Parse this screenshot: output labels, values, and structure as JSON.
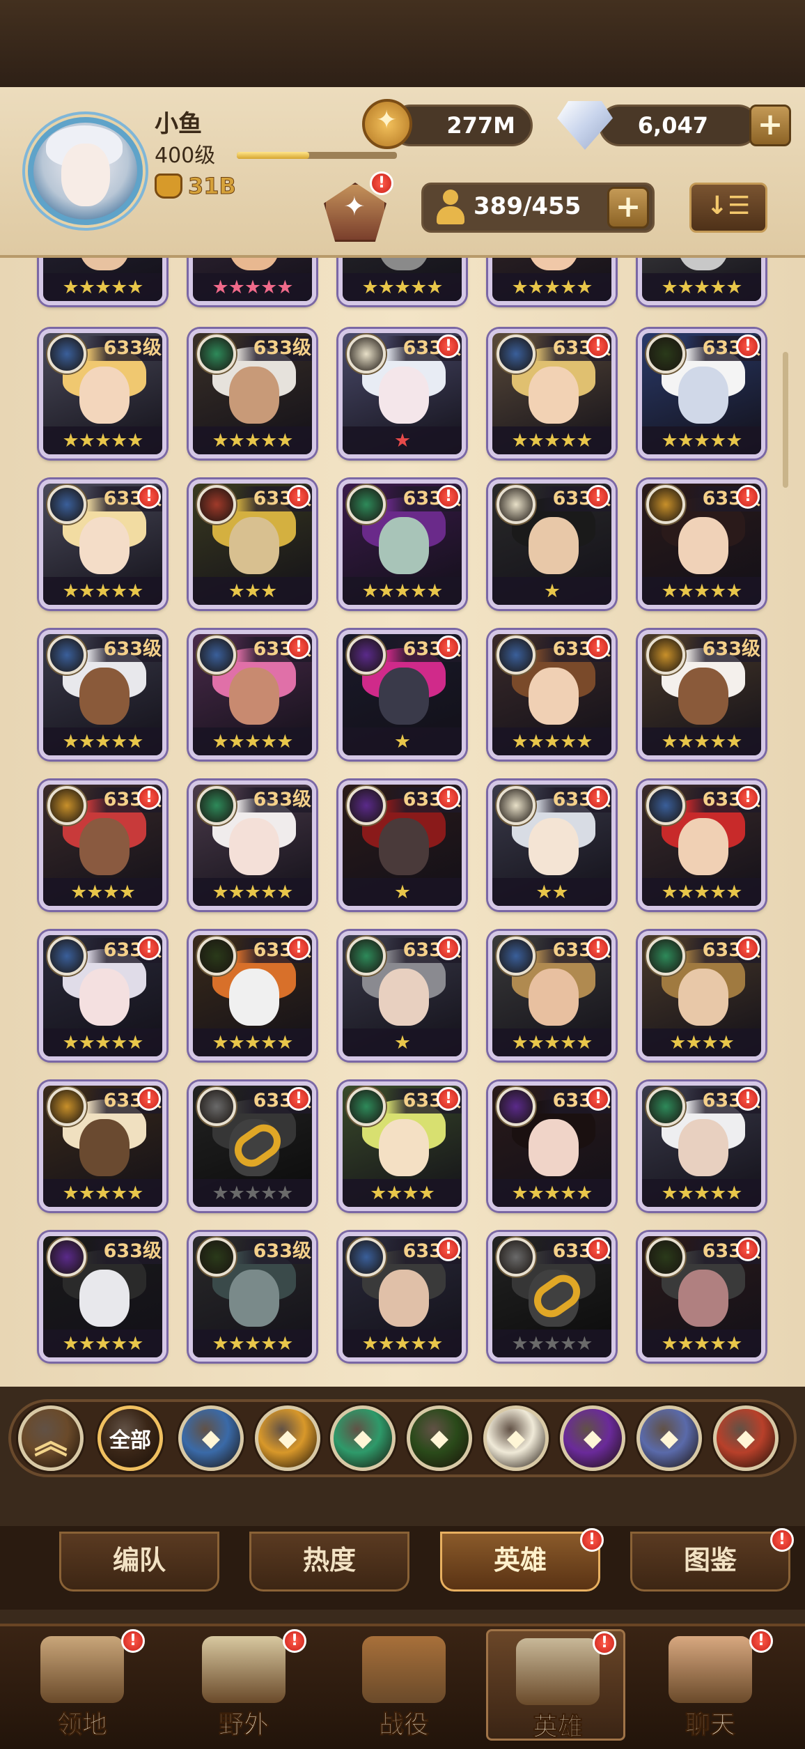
{
  "player": {
    "name": "小鱼",
    "level": "400级",
    "power": "31B",
    "xp_progress": 0.45
  },
  "currency": {
    "gold": "277M",
    "gems": "6,047"
  },
  "hero_count": "389/455",
  "sort_label": "↓☰",
  "heroes": [
    {
      "level": "",
      "stars": "★★★★★",
      "color": "#e8c64a",
      "faction": "#3a5f9a",
      "bg": "#2a2738",
      "hair": "#c9c8c4",
      "skin": "#e8c2a0",
      "badge": false
    },
    {
      "level": "",
      "stars": "★★★★★",
      "color": "#f06a8a",
      "faction": "#3a5f9a",
      "bg": "#3a2a3c",
      "hair": "#eeeeea",
      "skin": "#e8b890",
      "badge": false
    },
    {
      "level": "",
      "stars": "★★★★★",
      "color": "#e8c64a",
      "faction": "#3a5f9a",
      "bg": "#2c2c30",
      "hair": "#6a6a6e",
      "skin": "#8a8a8a",
      "badge": false
    },
    {
      "level": "",
      "stars": "★★★★★",
      "color": "#e8c64a",
      "faction": "#3a5f9a",
      "bg": "#3a2a2a",
      "hair": "#b8402a",
      "skin": "#f0c8a8",
      "badge": false
    },
    {
      "level": "",
      "stars": "★★★★★",
      "color": "#e8c64a",
      "faction": "#3a5f9a",
      "bg": "#4a4a4a",
      "hair": "#dcdcd8",
      "skin": "#c8c8c8",
      "badge": false
    },
    {
      "level": "633级",
      "stars": "★★★★★",
      "color": "#e8c64a",
      "faction": "#3a5f9a",
      "bg": "#4a4a5a",
      "hair": "#f0c870",
      "skin": "#f3d6bc",
      "badge": false
    },
    {
      "level": "633级",
      "stars": "★★★★★",
      "color": "#e8c64a",
      "faction": "#2e8a5a",
      "bg": "#3a3028",
      "hair": "#e6e2dc",
      "skin": "#c89a78",
      "badge": false
    },
    {
      "level": "633级",
      "stars": "★",
      "color": "#e64a4a",
      "faction": "#e8e0c8",
      "bg": "#4a4a6a",
      "hair": "#e8ecf4",
      "skin": "#f4e6ea",
      "badge": true
    },
    {
      "level": "633级",
      "stars": "★★★★★",
      "color": "#e8c64a",
      "faction": "#3a5f9a",
      "bg": "#5a4a3a",
      "hair": "#e0c070",
      "skin": "#f2d2b4",
      "badge": true
    },
    {
      "level": "633级",
      "stars": "★★★★★",
      "color": "#e8c64a",
      "faction": "#2a3a1a",
      "bg": "#2a3a6a",
      "hair": "#f4f4f4",
      "skin": "#d0d8e8",
      "badge": true
    },
    {
      "level": "633级",
      "stars": "★★★★★",
      "color": "#e8c64a",
      "faction": "#3a5f9a",
      "bg": "#4a4a5a",
      "hair": "#f2dca2",
      "skin": "#f4ddc8",
      "badge": true
    },
    {
      "level": "633级",
      "stars": "★★★",
      "color": "#e8c64a",
      "faction": "#a03a2a",
      "bg": "#3a3a20",
      "hair": "#d4b040",
      "skin": "#d8c090",
      "badge": true
    },
    {
      "level": "633级",
      "stars": "★★★★★",
      "color": "#e8c64a",
      "faction": "#2e8a5a",
      "bg": "#3a1a4a",
      "hair": "#6a2a8a",
      "skin": "#a8c4b8",
      "badge": true
    },
    {
      "level": "633级",
      "stars": "★",
      "color": "#e8c64a",
      "faction": "#e8e0c8",
      "bg": "#2a2a2a",
      "hair": "#1a1a1a",
      "skin": "#e8c8a8",
      "badge": true
    },
    {
      "level": "633级",
      "stars": "★★★★★",
      "color": "#e8c64a",
      "faction": "#c8902a",
      "bg": "#2a1a1a",
      "hair": "#2a1a1a",
      "skin": "#f0d2b8",
      "badge": true
    },
    {
      "level": "633级",
      "stars": "★★★★★",
      "color": "#e8c64a",
      "faction": "#3a5f9a",
      "bg": "#3a3a4a",
      "hair": "#e8e8ec",
      "skin": "#8a5a3a",
      "badge": false
    },
    {
      "level": "633级",
      "stars": "★★★★★",
      "color": "#e8c64a",
      "faction": "#3a5f9a",
      "bg": "#4a2a4a",
      "hair": "#e070a8",
      "skin": "#c88a70",
      "badge": true
    },
    {
      "level": "633级",
      "stars": "★",
      "color": "#e8c64a",
      "faction": "#5a2a8a",
      "bg": "#1a1a2a",
      "hair": "#d02a8a",
      "skin": "#3a3a4a",
      "badge": true
    },
    {
      "level": "633级",
      "stars": "★★★★★",
      "color": "#e8c64a",
      "faction": "#3a5f9a",
      "bg": "#3a2a2a",
      "hair": "#7a4a2a",
      "skin": "#f0d0b4",
      "badge": true
    },
    {
      "level": "633级",
      "stars": "★★★★★",
      "color": "#e8c64a",
      "faction": "#c8902a",
      "bg": "#4a3a2a",
      "hair": "#f4f0ec",
      "skin": "#8a5a3a",
      "badge": false
    },
    {
      "level": "633级",
      "stars": "★★★★",
      "color": "#e8c64a",
      "faction": "#c8902a",
      "bg": "#3a2a2a",
      "hair": "#c83a3a",
      "skin": "#8a5a40",
      "badge": true
    },
    {
      "level": "633级",
      "stars": "★★★★★",
      "color": "#e8c64a",
      "faction": "#2e8a5a",
      "bg": "#4a3a4a",
      "hair": "#f0ecec",
      "skin": "#f4e0d8",
      "badge": false
    },
    {
      "level": "633级",
      "stars": "★",
      "color": "#e8c64a",
      "faction": "#5a2a8a",
      "bg": "#2a1a1a",
      "hair": "#8a1a1a",
      "skin": "#4a3a3a",
      "badge": true
    },
    {
      "level": "633级",
      "stars": "★★",
      "color": "#e8c64a",
      "faction": "#e8e0c8",
      "bg": "#3a3a4a",
      "hair": "#d8dce4",
      "skin": "#f4e4d4",
      "badge": true
    },
    {
      "level": "633级",
      "stars": "★★★★★",
      "color": "#e8c64a",
      "faction": "#3a5f9a",
      "bg": "#3a2a2a",
      "hair": "#c82a2a",
      "skin": "#f0d0b4",
      "badge": true
    },
    {
      "level": "633级",
      "stars": "★★★★★",
      "color": "#e8c64a",
      "faction": "#3a5f9a",
      "bg": "#2a2a3a",
      "hair": "#e0dce8",
      "skin": "#f4e0e0",
      "badge": true
    },
    {
      "level": "633级",
      "stars": "★★★★★",
      "color": "#e8c64a",
      "faction": "#2a3a1a",
      "bg": "#3a2a1a",
      "hair": "#d8702a",
      "skin": "#f0f0f0",
      "badge": true
    },
    {
      "level": "633级",
      "stars": "★",
      "color": "#e8c64a",
      "faction": "#2e8a5a",
      "bg": "#3a3a4a",
      "hair": "#8a8a90",
      "skin": "#e8d0c0",
      "badge": true
    },
    {
      "level": "633级",
      "stars": "★★★★★",
      "color": "#e8c64a",
      "faction": "#3a5f9a",
      "bg": "#3a3a3a",
      "hair": "#b08a50",
      "skin": "#e8c0a0",
      "badge": true
    },
    {
      "level": "633级",
      "stars": "★★★★",
      "color": "#e8c64a",
      "faction": "#2e8a5a",
      "bg": "#4a3a2a",
      "hair": "#a07a40",
      "skin": "#e8c8a8",
      "badge": true
    },
    {
      "level": "633级",
      "stars": "★★★★★",
      "color": "#e8c64a",
      "faction": "#c8902a",
      "bg": "#3a2a1a",
      "hair": "#f0e0c0",
      "skin": "#6a4a30",
      "badge": true
    },
    {
      "level": "633级",
      "stars": "★★★★★",
      "color": "#6a6a6a",
      "faction": "#6a6a6a",
      "bg": "#3a3a3a",
      "hair": "#5a5a5a",
      "skin": "#6a6a6a",
      "badge": true,
      "locked": true
    },
    {
      "level": "633级",
      "stars": "★★★★",
      "color": "#e8c64a",
      "faction": "#2e8a5a",
      "bg": "#3a4a2a",
      "hair": "#d8e070",
      "skin": "#f4e0c4",
      "badge": true
    },
    {
      "level": "633级",
      "stars": "★★★★★",
      "color": "#e8c64a",
      "faction": "#5a2a8a",
      "bg": "#2a1a1a",
      "hair": "#1a1010",
      "skin": "#f0d4c8",
      "badge": true
    },
    {
      "level": "633级",
      "stars": "★★★★★",
      "color": "#e8c64a",
      "faction": "#2e8a5a",
      "bg": "#3a3a4a",
      "hair": "#eeeef0",
      "skin": "#e8d0c0",
      "badge": true
    },
    {
      "level": "633级",
      "stars": "★★★★★",
      "color": "#e8c64a",
      "faction": "#5a2a8a",
      "bg": "#1a1a1a",
      "hair": "#2a2a2a",
      "skin": "#e8e8ec",
      "badge": false
    },
    {
      "level": "633级",
      "stars": "★★★★★",
      "color": "#e8c64a",
      "faction": "#2a3a1a",
      "bg": "#2a2a2a",
      "hair": "#3a4a4a",
      "skin": "#7a8a8a",
      "badge": false
    },
    {
      "level": "633级",
      "stars": "★★★★★",
      "color": "#e8c64a",
      "faction": "#3a5f9a",
      "bg": "#2a2a3a",
      "hair": "#3a3a3a",
      "skin": "#e0c0a8",
      "badge": true
    },
    {
      "level": "633级",
      "stars": "★★★★★",
      "color": "#6a6a6a",
      "faction": "#6a6a6a",
      "bg": "#3a3a3a",
      "hair": "#5a5a5a",
      "skin": "#6a6a6a",
      "badge": true,
      "locked": true
    },
    {
      "level": "633级",
      "stars": "★★★★★",
      "color": "#e8c64a",
      "faction": "#2a3a1a",
      "bg": "#2a1a1a",
      "hair": "#3a3a3a",
      "skin": "#b08080",
      "badge": true
    }
  ],
  "filters": [
    {
      "label": "",
      "icon": "double-chevron-up-icon",
      "color": "#6a4a2a"
    },
    {
      "label": "全部",
      "icon": "all-icon",
      "color": "#3a2617"
    },
    {
      "label": "",
      "icon": "lightbearer-faction-icon",
      "color": "#3a6aa8"
    },
    {
      "label": "",
      "icon": "mauler-faction-icon",
      "color": "#d8982a"
    },
    {
      "label": "",
      "icon": "wilder-faction-icon",
      "color": "#2e9a6a"
    },
    {
      "label": "",
      "icon": "graveborn-faction-icon",
      "color": "#2a4a1a"
    },
    {
      "label": "",
      "icon": "celestial-faction-icon",
      "color": "#f0ead8"
    },
    {
      "label": "",
      "icon": "hypogean-faction-icon",
      "color": "#6a2a9a"
    },
    {
      "label": "",
      "icon": "dimensional-faction-icon",
      "color": "#5a6aaa"
    },
    {
      "label": "",
      "icon": "fire-faction-icon",
      "color": "#b8402a"
    }
  ],
  "tabs": [
    {
      "label": "编队",
      "active": false
    },
    {
      "label": "热度",
      "active": false
    },
    {
      "label": "英雄",
      "active": true
    },
    {
      "label": "图鉴",
      "active": false
    }
  ],
  "nav": [
    {
      "label": "领地",
      "icon": "castle-icon",
      "active": false
    },
    {
      "label": "野外",
      "icon": "scroll-map-icon",
      "active": false
    },
    {
      "label": "战役",
      "icon": "sword-crest-icon",
      "active": false
    },
    {
      "label": "英雄",
      "icon": "knight-helmet-icon",
      "active": true
    },
    {
      "label": "聊天",
      "icon": "chat-bubble-icon",
      "active": false
    }
  ],
  "badge_mark": "!"
}
